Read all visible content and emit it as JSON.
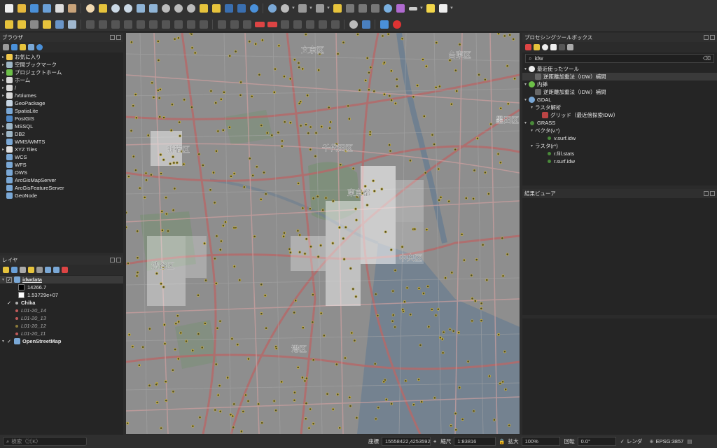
{
  "browser": {
    "title": "ブラウザ",
    "items": [
      {
        "label": "お気に入り",
        "icon": "star-icon",
        "color": "#f2c94c",
        "arrow": "▸"
      },
      {
        "label": "空間ブックマーク",
        "icon": "bookmark-icon",
        "color": "#9fb7c7",
        "arrow": "▸"
      },
      {
        "label": "プロジェクトホーム",
        "icon": "project-home-icon",
        "color": "#6cbf48",
        "arrow": "▸"
      },
      {
        "label": "ホーム",
        "icon": "folder-icon",
        "color": "#d9d9d9",
        "arrow": "▸"
      },
      {
        "label": "/",
        "icon": "folder-icon",
        "color": "#d9d9d9",
        "arrow": "▸"
      },
      {
        "label": "/Volumes",
        "icon": "folder-icon",
        "color": "#d9d9d9",
        "arrow": "▸"
      },
      {
        "label": "GeoPackage",
        "icon": "geopackage-icon",
        "color": "#c6d5e3",
        "arrow": ""
      },
      {
        "label": "SpatiaLite",
        "icon": "spatialite-icon",
        "color": "#7aa8d6",
        "arrow": ""
      },
      {
        "label": "PostGIS",
        "icon": "postgis-icon",
        "color": "#4d86c4",
        "arrow": ""
      },
      {
        "label": "MSSQL",
        "icon": "mssql-icon",
        "color": "#9fb7c7",
        "arrow": "▸"
      },
      {
        "label": "DB2",
        "icon": "db2-icon",
        "color": "#9fb7c7",
        "arrow": "▸"
      },
      {
        "label": "WMS/WMTS",
        "icon": "globe-icon",
        "color": "#7aa8d6",
        "arrow": ""
      },
      {
        "label": "XYZ Tiles",
        "icon": "xyz-tiles-icon",
        "color": "#e0e0e0",
        "arrow": "▸"
      },
      {
        "label": "WCS",
        "icon": "globe-icon",
        "color": "#7aa8d6",
        "arrow": ""
      },
      {
        "label": "WFS",
        "icon": "globe-icon",
        "color": "#7aa8d6",
        "arrow": ""
      },
      {
        "label": "OWS",
        "icon": "globe-icon",
        "color": "#7aa8d6",
        "arrow": ""
      },
      {
        "label": "ArcGisMapServer",
        "icon": "arcgis-icon",
        "color": "#7aa8d6",
        "arrow": ""
      },
      {
        "label": "ArcGisFeatureServer",
        "icon": "arcgis-icon",
        "color": "#7aa8d6",
        "arrow": ""
      },
      {
        "label": "GeoNode",
        "icon": "geonode-icon",
        "color": "#7aa8d6",
        "arrow": ""
      }
    ]
  },
  "layers": {
    "title": "レイヤ",
    "idw": {
      "name": "idwdata",
      "min": "14266.7",
      "max": "1.53729e+07"
    },
    "chika": {
      "name": "Chika",
      "dot": "#b0b0b0"
    },
    "sublayers": [
      {
        "name": "L01-20_14",
        "dot": "#c05a5a"
      },
      {
        "name": "L01-20_13",
        "dot": "#c05a5a"
      },
      {
        "name": "L01-20_12",
        "dot": "#8a7a3a"
      },
      {
        "name": "L01-20_11",
        "dot": "#c05a5a"
      }
    ],
    "osm": {
      "name": "OpenStreetMap"
    }
  },
  "processing": {
    "title": "プロセシングツールボックス",
    "search": "idw",
    "recent": "最近使ったツール",
    "recent_tool": "逆距離加重法（IDW）補間",
    "native": "内挿",
    "native_tool": "逆距離加重法（IDW）補間",
    "gdal": "GDAL",
    "gdal_raster": "ラスタ解析",
    "gdal_tool": "グリッド（最近傍探索IDW）",
    "grass": "GRASS",
    "grass_vector": "ベクタ(v.*)",
    "grass_vtool": "v.surf.idw",
    "grass_raster": "ラスタ(r*)",
    "grass_rtool1": "r.fill.stats",
    "grass_rtool2": "r.surf.idw"
  },
  "results": {
    "title": "結果ビューア"
  },
  "map": {
    "labels": {
      "bunkyo": "文京区",
      "taito": "台東区",
      "shinjuku": "新宿区",
      "chiyoda": "千代田区",
      "sumida": "墨田区",
      "tokyo": "東京都",
      "shibuya": "渋谷区",
      "chuo": "中央区",
      "minato": "港区"
    }
  },
  "status": {
    "search_placeholder": "検索（⌘K）",
    "coord_label": "座標",
    "coord": "15558422,4253592",
    "scale_label": "縮尺",
    "scale": "1:83816",
    "zoom_label": "拡大",
    "zoom": "100%",
    "rotation_label": "回転",
    "rotation": "0.0°",
    "render_label": "レンダ",
    "crs": "EPSG:3857"
  }
}
